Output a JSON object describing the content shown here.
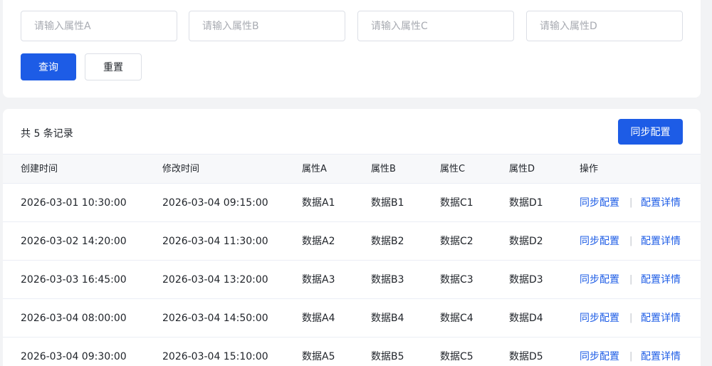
{
  "filters": {
    "a_placeholder": "请输入属性A",
    "b_placeholder": "请输入属性B",
    "c_placeholder": "请输入属性C",
    "d_placeholder": "请输入属性D",
    "search_label": "查询",
    "reset_label": "重置"
  },
  "table": {
    "record_count": "共 5 条记录",
    "sync_button_label": "同步配置",
    "columns": [
      "创建时间",
      "修改时间",
      "属性A",
      "属性B",
      "属性C",
      "属性D",
      "操作"
    ],
    "rows": [
      {
        "created": "2026-03-01 10:30:00",
        "modified": "2026-03-04 09:15:00",
        "a": "数据A1",
        "b": "数据B1",
        "c": "数据C1",
        "d": "数据D1",
        "action_sync": "同步配置",
        "sep": "|",
        "action_detail": "配置详情"
      },
      {
        "created": "2026-03-02 14:20:00",
        "modified": "2026-03-04 11:30:00",
        "a": "数据A2",
        "b": "数据B2",
        "c": "数据C2",
        "d": "数据D2",
        "action_sync": "同步配置",
        "sep": "|",
        "action_detail": "配置详情"
      },
      {
        "created": "2026-03-03 16:45:00",
        "modified": "2026-03-04 13:20:00",
        "a": "数据A3",
        "b": "数据B3",
        "c": "数据C3",
        "d": "数据D3",
        "action_sync": "同步配置",
        "sep": "|",
        "action_detail": "配置详情"
      },
      {
        "created": "2026-03-04 08:00:00",
        "modified": "2026-03-04 14:50:00",
        "a": "数据A4",
        "b": "数据B4",
        "c": "数据C4",
        "d": "数据D4",
        "action_sync": "同步配置",
        "sep": "|",
        "action_detail": "配置详情"
      },
      {
        "created": "2026-03-04 09:30:00",
        "modified": "2026-03-04 15:10:00",
        "a": "数据A5",
        "b": "数据B5",
        "c": "数据C5",
        "d": "数据D5",
        "action_sync": "同步配置",
        "sep": "|",
        "action_detail": "配置详情"
      }
    ]
  },
  "colors": {
    "primary": "#1d5ce6",
    "background": "#f2f3f5",
    "header_bg": "#f7f8fa"
  }
}
